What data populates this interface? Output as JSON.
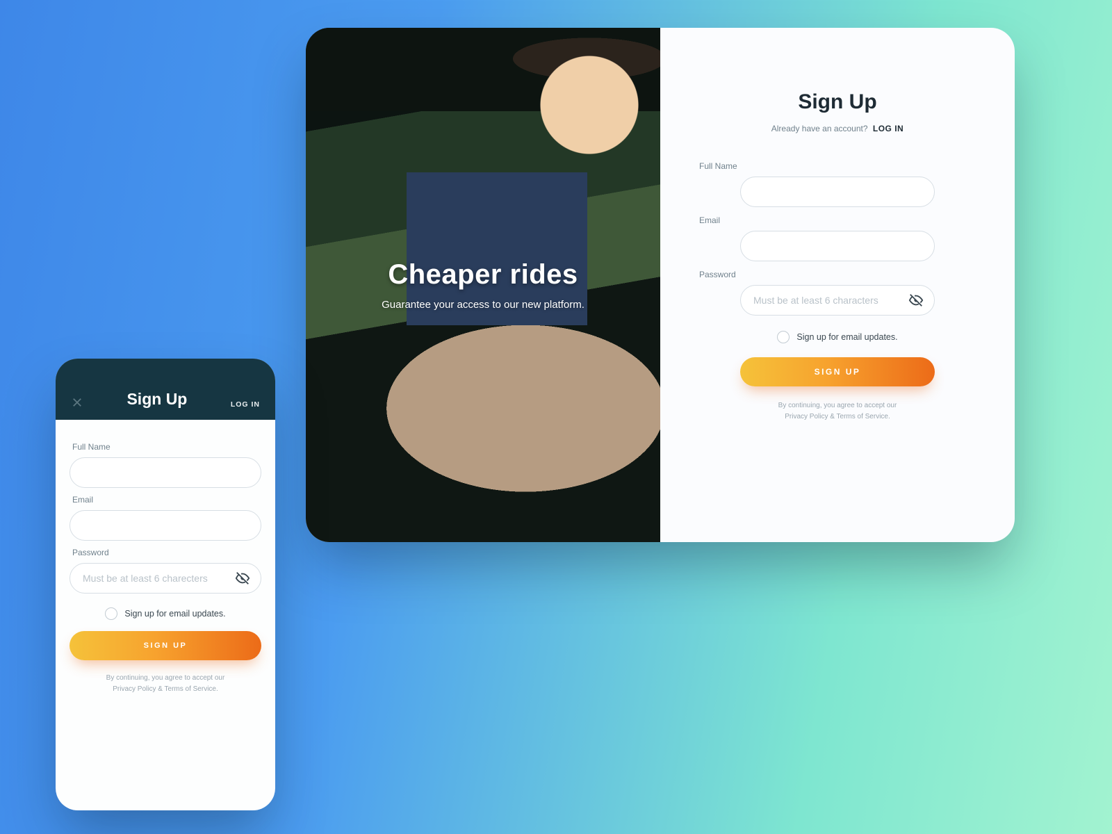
{
  "hero": {
    "title": "Cheaper rides",
    "subtitle": "Guarantee your access to our new platform."
  },
  "signup": {
    "title": "Sign Up",
    "already_prompt": "Already have an account?",
    "login_link": "LOG IN",
    "fullname_label": "Full Name",
    "email_label": "Email",
    "password_label": "Password",
    "password_placeholder": "Must be at least 6 characters",
    "optin_label": "Sign up for email updates.",
    "submit_label": "SIGN UP",
    "legal_line1": "By continuing, you agree to accept our",
    "legal_line2": "Privacy Policy & Terms of Service."
  },
  "mobile": {
    "title": "Sign Up",
    "login_link": "LOG IN",
    "fullname_label": "Full Name",
    "email_label": "Email",
    "password_label": "Password",
    "password_placeholder": "Must be at least 6 charecters",
    "optin_label": "Sign up for email updates.",
    "submit_label": "SIGN UP",
    "legal_line1": "By continuing, you agree to accept our",
    "legal_line2": "Privacy Policy & Terms of Service."
  },
  "colors": {
    "accent_gradient_start": "#f5c23a",
    "accent_gradient_end": "#ec6b18",
    "header_dark": "#163642"
  }
}
